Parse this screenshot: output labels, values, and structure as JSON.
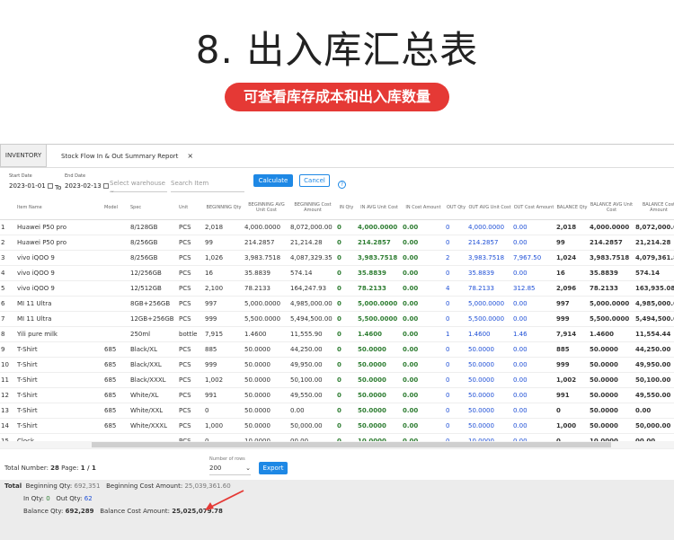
{
  "header": {
    "title": "8. 出入库汇总表",
    "pill": "可查看库存成本和出入库数量"
  },
  "tabs": {
    "inventory": "INVENTORY",
    "report": "Stock Flow In & Out Summary Report",
    "close": "×"
  },
  "filters": {
    "start_label": "Start Date",
    "start_value": "2023-01-01",
    "to": "To",
    "end_label": "End Date",
    "end_value": "2023-02-13",
    "warehouse_placeholder": "Select warehouse",
    "item_placeholder": "Search Item",
    "calculate": "Calculate",
    "cancel": "Cancel",
    "help": "?"
  },
  "columns": [
    "",
    "Item Name",
    "Model",
    "Spec",
    "Unit",
    "BEGINNING Qty",
    "BEGINNING AVG Unit Cost",
    "BEGINNING Cost Amount",
    "IN Qty",
    "IN AVG Unit Cost",
    "IN Cost Amount",
    "OUT Qty",
    "OUT AVG Unit Cost",
    "OUT Cost Amount",
    "BALANCE Qty",
    "BALANCE AVG Unit Cost",
    "BALANCE Cost Amount"
  ],
  "rows": [
    [
      "1",
      "Huawei P50 pro",
      "",
      "8/128GB",
      "PCS",
      "2,018",
      "4,000.0000",
      "8,072,000.00",
      "0",
      "4,000.0000",
      "0.00",
      "0",
      "4,000.0000",
      "0.00",
      "2,018",
      "4,000.0000",
      "8,072,000.00"
    ],
    [
      "2",
      "Huawei P50 pro",
      "",
      "8/256GB",
      "PCS",
      "99",
      "214.2857",
      "21,214.28",
      "0",
      "214.2857",
      "0.00",
      "0",
      "214.2857",
      "0.00",
      "99",
      "214.2857",
      "21,214.28"
    ],
    [
      "3",
      "vivo iQOO 9",
      "",
      "8/256GB",
      "PCS",
      "1,026",
      "3,983.7518",
      "4,087,329.35",
      "0",
      "3,983.7518",
      "0.00",
      "2",
      "3,983.7518",
      "7,967.50",
      "1,024",
      "3,983.7518",
      "4,079,361.84"
    ],
    [
      "4",
      "vivo iQOO 9",
      "",
      "12/256GB",
      "PCS",
      "16",
      "35.8839",
      "574.14",
      "0",
      "35.8839",
      "0.00",
      "0",
      "35.8839",
      "0.00",
      "16",
      "35.8839",
      "574.14"
    ],
    [
      "5",
      "vivo iQOO 9",
      "",
      "12/512GB",
      "PCS",
      "2,100",
      "78.2133",
      "164,247.93",
      "0",
      "78.2133",
      "0.00",
      "4",
      "78.2133",
      "312.85",
      "2,096",
      "78.2133",
      "163,935.08"
    ],
    [
      "6",
      "MI 11 Ultra",
      "",
      "8GB+256GB",
      "PCS",
      "997",
      "5,000.0000",
      "4,985,000.00",
      "0",
      "5,000.0000",
      "0.00",
      "0",
      "5,000.0000",
      "0.00",
      "997",
      "5,000.0000",
      "4,985,000.00"
    ],
    [
      "7",
      "MI 11 Ultra",
      "",
      "12GB+256GB",
      "PCS",
      "999",
      "5,500.0000",
      "5,494,500.00",
      "0",
      "5,500.0000",
      "0.00",
      "0",
      "5,500.0000",
      "0.00",
      "999",
      "5,500.0000",
      "5,494,500.00"
    ],
    [
      "8",
      "Yili pure milk",
      "",
      "250ml",
      "bottle",
      "7,915",
      "1.4600",
      "11,555.90",
      "0",
      "1.4600",
      "0.00",
      "1",
      "1.4600",
      "1.46",
      "7,914",
      "1.4600",
      "11,554.44"
    ],
    [
      "9",
      "T-Shirt",
      "685",
      "Black/XL",
      "PCS",
      "885",
      "50.0000",
      "44,250.00",
      "0",
      "50.0000",
      "0.00",
      "0",
      "50.0000",
      "0.00",
      "885",
      "50.0000",
      "44,250.00"
    ],
    [
      "10",
      "T-Shirt",
      "685",
      "Black/XXL",
      "PCS",
      "999",
      "50.0000",
      "49,950.00",
      "0",
      "50.0000",
      "0.00",
      "0",
      "50.0000",
      "0.00",
      "999",
      "50.0000",
      "49,950.00"
    ],
    [
      "11",
      "T-Shirt",
      "685",
      "Black/XXXL",
      "PCS",
      "1,002",
      "50.0000",
      "50,100.00",
      "0",
      "50.0000",
      "0.00",
      "0",
      "50.0000",
      "0.00",
      "1,002",
      "50.0000",
      "50,100.00"
    ],
    [
      "12",
      "T-Shirt",
      "685",
      "White/XL",
      "PCS",
      "991",
      "50.0000",
      "49,550.00",
      "0",
      "50.0000",
      "0.00",
      "0",
      "50.0000",
      "0.00",
      "991",
      "50.0000",
      "49,550.00"
    ],
    [
      "13",
      "T-Shirt",
      "685",
      "White/XXL",
      "PCS",
      "0",
      "50.0000",
      "0.00",
      "0",
      "50.0000",
      "0.00",
      "0",
      "50.0000",
      "0.00",
      "0",
      "50.0000",
      "0.00"
    ],
    [
      "14",
      "T-Shirt",
      "685",
      "White/XXXL",
      "PCS",
      "1,000",
      "50.0000",
      "50,000.00",
      "0",
      "50.0000",
      "0.00",
      "0",
      "50.0000",
      "0.00",
      "1,000",
      "50.0000",
      "50,000.00"
    ],
    [
      "15",
      "Clock",
      "",
      "",
      "PCS",
      "0",
      "10.0000",
      "00.00",
      "0",
      "10.0000",
      "0.00",
      "0",
      "10.0000",
      "0.00",
      "0",
      "10.0000",
      "00.00"
    ]
  ],
  "pager": {
    "total_label": "Total Number:",
    "total": "28",
    "page_label": "Page:",
    "page": "1 / 1",
    "rows_label": "Number of rows",
    "rows_value": "200",
    "export": "Export"
  },
  "totals": {
    "label": "Total",
    "beg_qty_label": "Beginning Qty:",
    "beg_qty": "692,351",
    "beg_cost_label": "Beginning Cost Amount:",
    "beg_cost": "25,039,361.60",
    "in_qty_label": "In Qty:",
    "in_qty": "0",
    "out_qty_label": "Out Qty:",
    "out_qty": "62",
    "bal_qty_label": "Balance Qty:",
    "bal_qty": "692,289",
    "bal_cost_label": "Balance Cost Amount:",
    "bal_cost": "25,025,079.78"
  },
  "colors": {
    "accent": "#1e88e5",
    "pill": "#e53935",
    "in_green": "#2e7d32",
    "link_blue": "#1e4fd6"
  }
}
